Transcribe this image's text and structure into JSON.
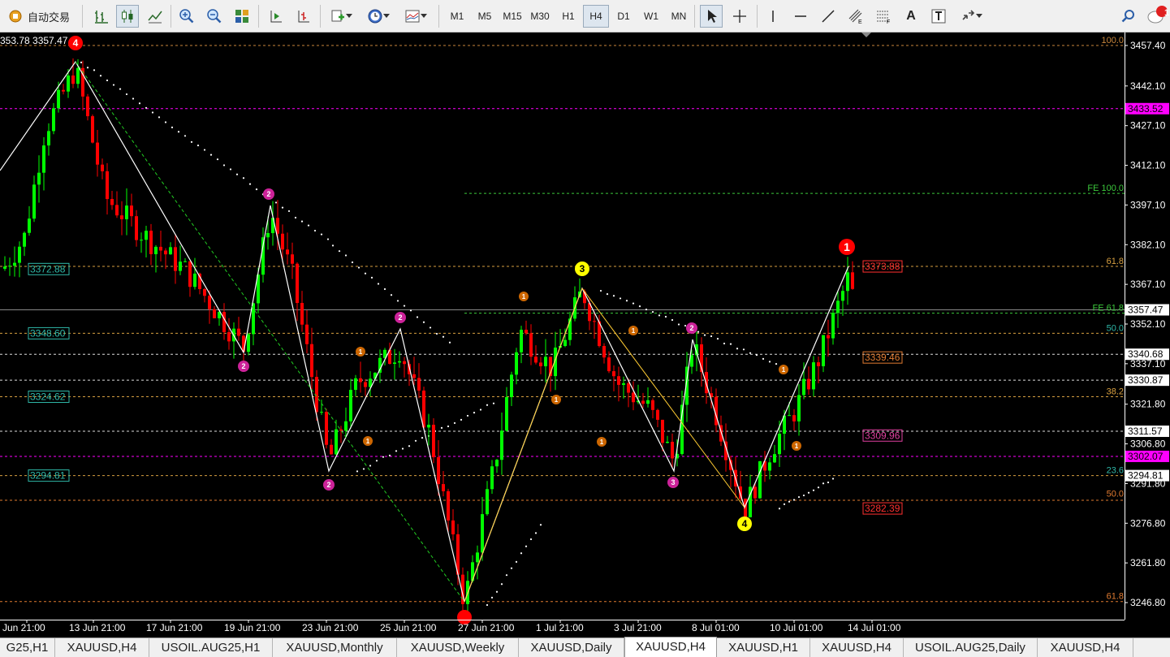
{
  "toolbar": {
    "autotrade_label": "自动交易",
    "timeframes": [
      "M1",
      "M5",
      "M15",
      "M30",
      "H1",
      "H4",
      "D1",
      "W1",
      "MN"
    ],
    "active_timeframe": "H4",
    "notification_count": "1",
    "text_tool": "A"
  },
  "chart": {
    "top_left_text": "353.78 3357.47",
    "price_ticks": [
      "3457.40",
      "3442.10",
      "3427.10",
      "3412.10",
      "3397.10",
      "3382.10",
      "3367.10",
      "3352.10",
      "3337.10",
      "3321.80",
      "3306.80",
      "3291.80",
      "3276.80",
      "3261.80",
      "3246.80"
    ],
    "price_labels": [
      {
        "text": "3433.52",
        "fill": "#ff00ff",
        "color": "#000000"
      },
      {
        "text": "3357.47",
        "fill": "#ffffff",
        "color": "#000000"
      },
      {
        "text": "3340.68",
        "fill": "#ffffff",
        "color": "#000000"
      },
      {
        "text": "3330.87",
        "fill": "#ffffff",
        "color": "#000000"
      },
      {
        "text": "3311.57",
        "fill": "#ffffff",
        "color": "#000000"
      },
      {
        "text": "3302.07",
        "fill": "#ff00ff",
        "color": "#000000"
      },
      {
        "text": "3294.81",
        "fill": "#ffffff",
        "color": "#000000"
      }
    ],
    "time_ticks": [
      "Jun 21:00",
      "13 Jun 21:00",
      "17 Jun 21:00",
      "19 Jun 21:00",
      "23 Jun 21:00",
      "25 Jun 21:00",
      "27 Jun 21:00",
      "1 Jul 21:00",
      "3 Jul 21:00",
      "8 Jul 01:00",
      "10 Jul 01:00",
      "14 Jul 01:00"
    ],
    "left_level_labels": [
      "3372.88",
      "3348.60",
      "3324.62",
      "3294.81"
    ],
    "right_level_labels": [
      "3373.88",
      "3339.46",
      "3309.96",
      "3282.39"
    ],
    "fib_labels": [
      "100.0",
      "FE 100.0",
      "61.8",
      "FE 61.8",
      "50.0",
      "38.2",
      "23.6",
      "50.0",
      "61.8"
    ],
    "wave_labels": [
      "4",
      "2",
      "2",
      "2",
      "2",
      "3",
      "2",
      "3",
      "4",
      "1",
      "1",
      "1",
      "1",
      "1",
      "1",
      "1",
      "1",
      "1"
    ],
    "colors": {
      "bull": "#00ff00",
      "bear": "#ff0000",
      "wave_red": "#ff0000",
      "wave_yellow": "#ffff00",
      "wave_magenta": "#cc2299",
      "wave_orange": "#cc6600"
    }
  },
  "tabs": [
    "G25,H1",
    "XAUUSD,H4",
    "USOIL.AUG25,H1",
    "XAUUSD,Monthly",
    "XAUUSD,Weekly",
    "XAUUSD,Daily",
    "XAUUSD,H4",
    "XAUUSD,H1",
    "XAUUSD,H4",
    "USOIL.AUG25,Daily",
    "XAUUSD,H4"
  ],
  "active_tab": 6
}
